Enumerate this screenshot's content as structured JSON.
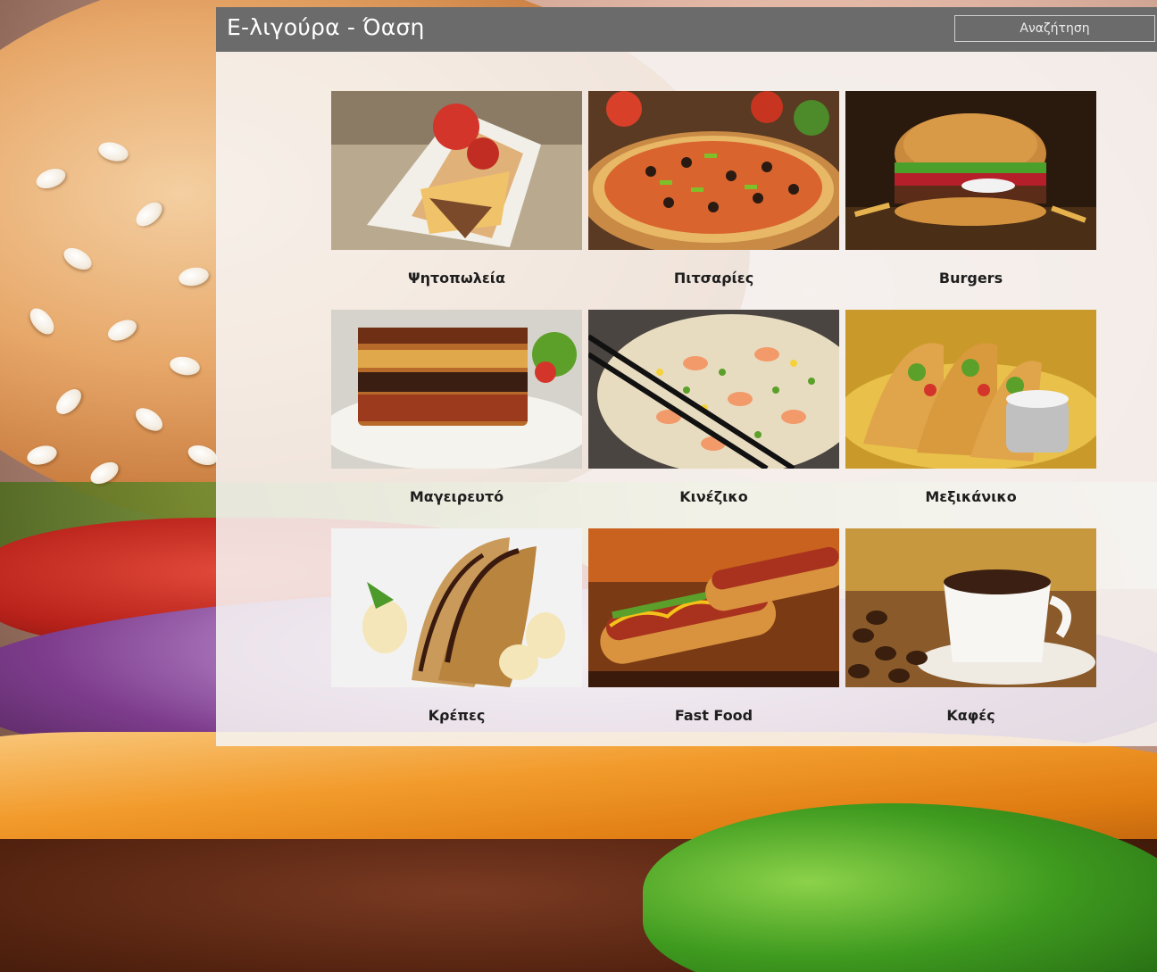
{
  "window": {
    "title": "Ε-λιγούρα - Όαση",
    "search_placeholder": "Αναζήτηση"
  },
  "categories": [
    {
      "label": "Ψητοπωλεία",
      "icon": "souvlaki-photo"
    },
    {
      "label": "Πιτσαρίες",
      "icon": "pizza-photo"
    },
    {
      "label": "Burgers",
      "icon": "burger-photo"
    },
    {
      "label": "Μαγειρευτό",
      "icon": "moussaka-photo"
    },
    {
      "label": "Κινέζικο",
      "icon": "fried-rice-photo"
    },
    {
      "label": "Μεξικάνικο",
      "icon": "tacos-photo"
    },
    {
      "label": "Κρέπες",
      "icon": "crepes-photo"
    },
    {
      "label": "Fast Food",
      "icon": "hotdog-photo"
    },
    {
      "label": "Καφές",
      "icon": "coffee-photo"
    }
  ],
  "colors": {
    "titlebar": "#6b6b6b",
    "panel": "#f6f4f3",
    "label_text": "#1e1e1e"
  }
}
